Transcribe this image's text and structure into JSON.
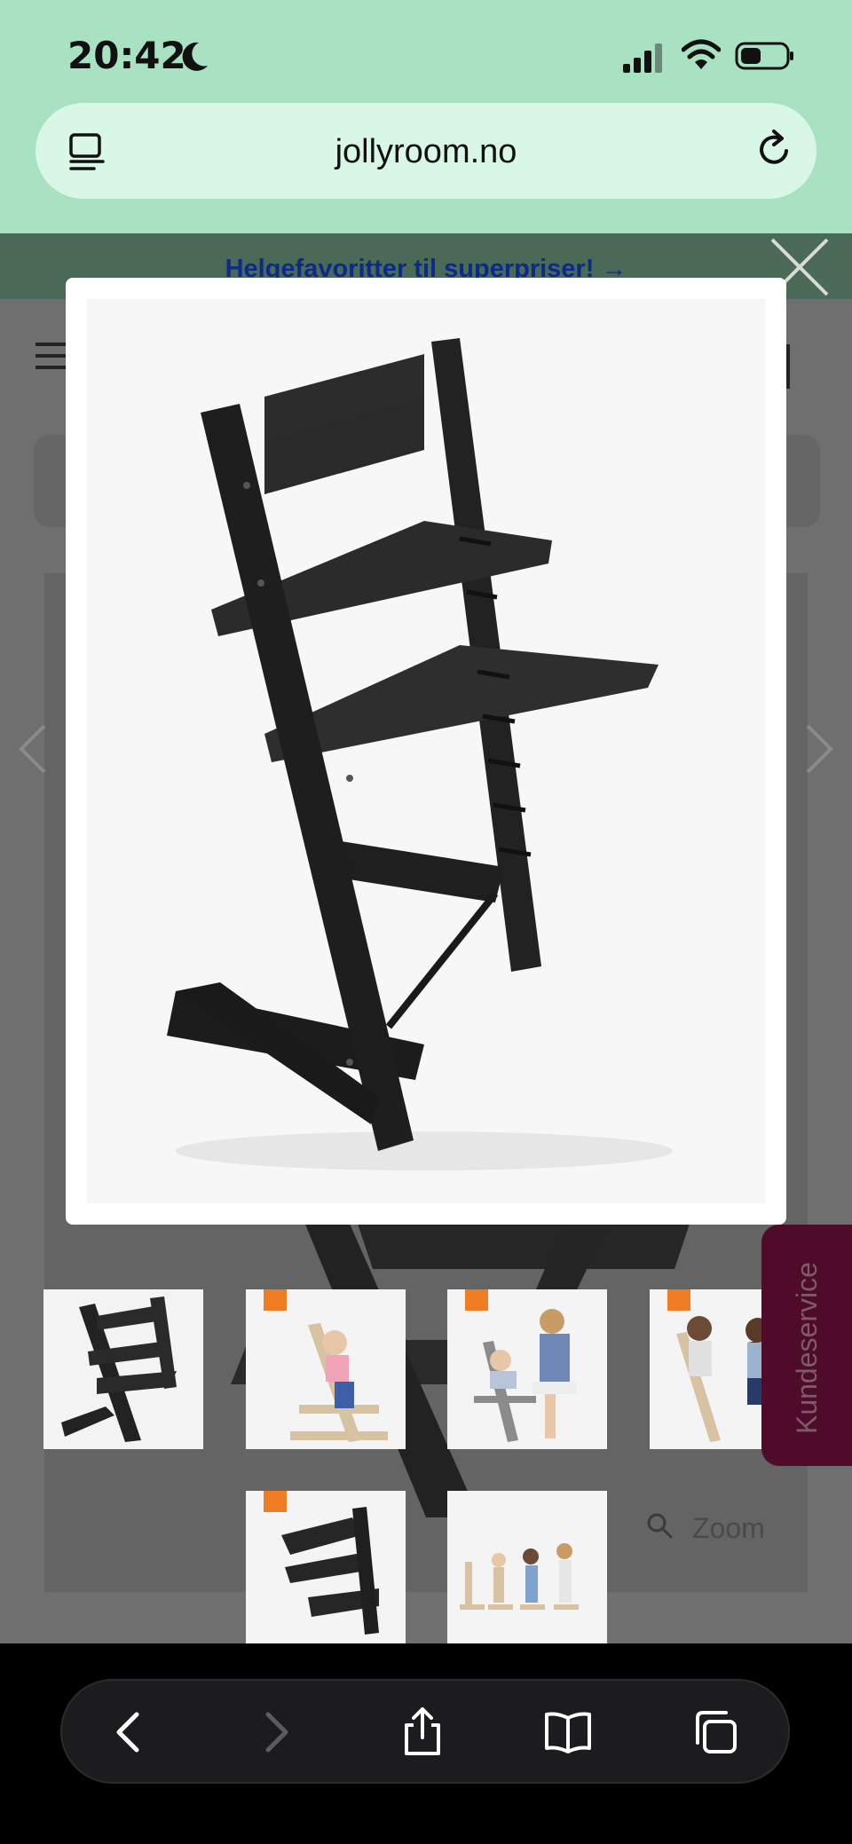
{
  "status_bar": {
    "time": "20:42",
    "icons": [
      "moon-icon",
      "signal-icon",
      "wifi-icon",
      "battery-icon"
    ]
  },
  "browser": {
    "url": "jollyroom.no",
    "page_menu_icon": "page-menu-icon",
    "reload_icon": "reload-icon"
  },
  "page": {
    "banner_text": "Helgefavoritter til superpriser! →",
    "zoom_label": "Zoom",
    "support_tab": "Kundeservice"
  },
  "lightbox": {
    "close_icon": "close-icon",
    "image_alt": "Tripp Trapp chair, black"
  },
  "thumbnails": [
    {
      "kind": "black-chair"
    },
    {
      "kind": "toddler-chair"
    },
    {
      "kind": "parent-baby"
    },
    {
      "kind": "two-kids"
    },
    {
      "kind": "black-chair-closeup"
    },
    {
      "kind": "chair-lineup"
    }
  ],
  "toolbar": {
    "buttons": [
      "back-icon",
      "forward-icon",
      "share-icon",
      "bookmarks-icon",
      "tabs-icon"
    ]
  },
  "colors": {
    "chrome_green": "#a9e2c3",
    "address_bg": "#d8f7e7",
    "brand_tab": "#4e0b2a",
    "overlay": "#6f6f6f"
  }
}
